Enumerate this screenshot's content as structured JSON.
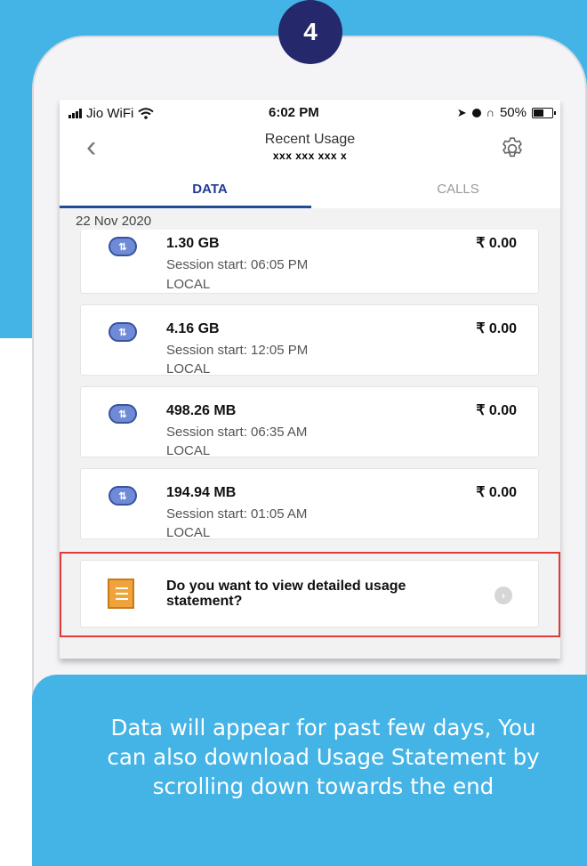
{
  "step_number": "4",
  "status_bar": {
    "carrier": "Jio WiFi",
    "time": "6:02 PM",
    "battery": "50%"
  },
  "header": {
    "back_icon": "chevron-left-icon",
    "title": "Recent Usage",
    "subtitle": "xxx xxx xxx x",
    "settings_icon": "gear-icon"
  },
  "tabs": [
    {
      "label": "DATA",
      "active": true
    },
    {
      "label": "CALLS",
      "active": false
    }
  ],
  "date_group": "22 Nov 2020",
  "sessions": [
    {
      "size": "1.30 GB",
      "session": "Session start: 06:05 PM",
      "type": "LOCAL",
      "amount": "₹ 0.00"
    },
    {
      "size": "4.16 GB",
      "session": "Session start: 12:05 PM",
      "type": "LOCAL",
      "amount": "₹ 0.00"
    },
    {
      "size": "498.26 MB",
      "session": "Session start: 06:35 AM",
      "type": "LOCAL",
      "amount": "₹ 0.00"
    },
    {
      "size": "194.94 MB",
      "session": "Session start: 01:05 AM",
      "type": "LOCAL",
      "amount": "₹ 0.00"
    }
  ],
  "statement_prompt": "Do you want to view detailed usage statement?",
  "info_text": "Data will appear for past few days, You can also download Usage Statement by scrolling down towards the end",
  "colors": {
    "background": "#44b3e5",
    "badge": "#25286a",
    "tab_active": "#1f3a93",
    "highlight_border": "#e03a3a"
  }
}
